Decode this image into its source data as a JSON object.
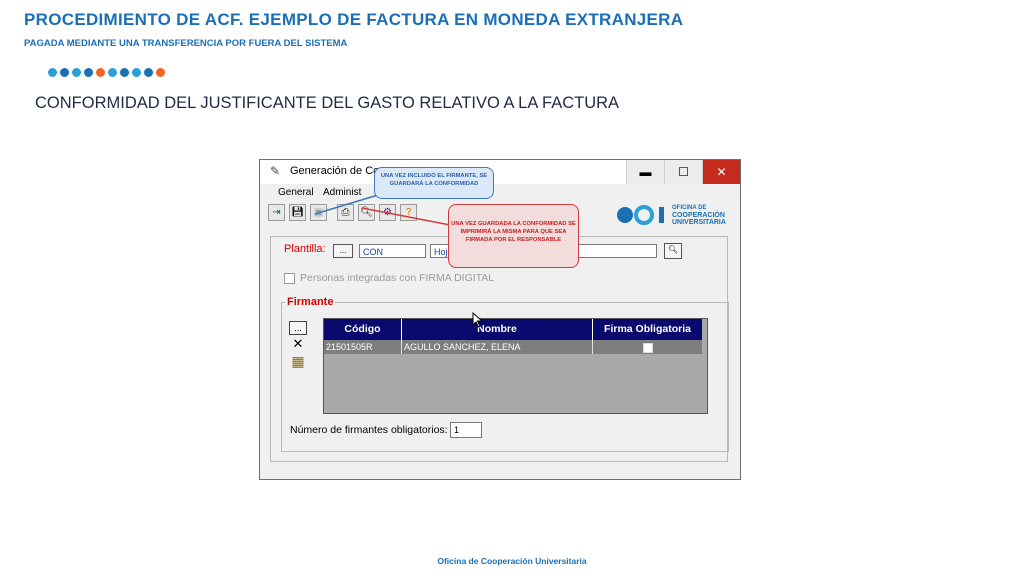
{
  "slide": {
    "title": "PROCEDIMIENTO DE ACF. EJEMPLO DE FACTURA EN MONEDA EXTRANJERA",
    "subtitle": "PAGADA MEDIANTE UNA TRANSFERENCIA POR FUERA DEL SISTEMA",
    "heading": "CONFORMIDAD DEL JUSTIFICANTE DEL GASTO RELATIVO A LA FACTURA",
    "footer": "Oficina de Cooperación Universitaria",
    "dot_colors": [
      "#2b9fd8",
      "#1a6fb5",
      "#2b9fd8",
      "#1a6fb5",
      "#f26522",
      "#2b9fd8",
      "#1a6fb5",
      "#2b9fd8",
      "#1a6fb5",
      "#f26522"
    ]
  },
  "window": {
    "title": "Generación de Conf",
    "controls": {
      "minimize": "▬",
      "maximize": "☐",
      "close": "✕"
    },
    "menu": [
      "General",
      "Administ"
    ],
    "toolbar_icons": [
      "exit-icon",
      "save-icon",
      "disabled-save-icon",
      "print-icon",
      "preview-icon",
      "tools-icon",
      "help-icon"
    ],
    "logo": {
      "line1": "OFICINA DE",
      "line2": "COOPERACIÓN",
      "line3": "UNIVERSITARIA"
    },
    "plantilla": {
      "label": "Plantilla:",
      "button": "...",
      "code": "CON",
      "description": "Hoja"
    },
    "personas": {
      "label": "Personas integradas con FIRMA DIGITAL"
    },
    "firmante": {
      "legend": "Firmante",
      "side_buttons": {
        "add": "...",
        "delete": "✕",
        "grid": "▦"
      },
      "columns": [
        "Código",
        "Nombre",
        "Firma Obligatoria"
      ],
      "rows": [
        {
          "codigo": "21501505R",
          "nombre": "AGULLO SANCHEZ, ELENA",
          "firma_obligatoria": true
        }
      ]
    },
    "num_firmantes": {
      "label": "Número de firmantes obligatorios:",
      "value": "1"
    }
  },
  "callouts": {
    "one": "UNA VEZ INCLUIDO EL FIRMANTE, SE GUARDARÁ LA CONFORMIDAD",
    "two": "UNA VEZ GUARDADA LA CONFORMIDAD SE IMPRIMIRÁ LA MISMA PARA QUE SEA FIRMADA POR EL RESPONSABLE"
  }
}
